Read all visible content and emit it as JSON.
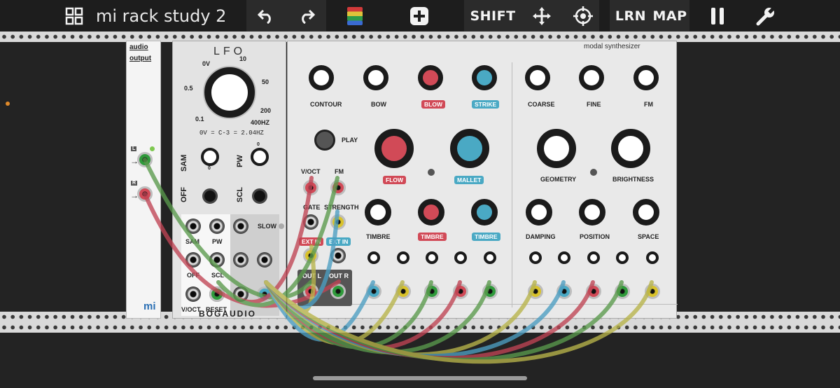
{
  "toolbar": {
    "title": "mi rack study 2",
    "shift": "SHIFT",
    "learn": "LRN",
    "map": "MAP"
  },
  "audio_output": {
    "title_line1": "audio",
    "title_line2": "output",
    "left": "L",
    "right": "R",
    "brand": "mi"
  },
  "lfo": {
    "title": "LFO",
    "freq_scale": [
      "0V",
      "10",
      "0.5",
      "50",
      "0.1",
      "200",
      "400HZ"
    ],
    "tuning_note": "0V = C-3 = 2.04HZ",
    "knobs": {
      "sam": "SAM",
      "pw": "PW",
      "off": "OFF",
      "scl": "SCL"
    },
    "scale_marks": {
      "sam_max": "0",
      "pw_max": "0",
      "sam_min": "0"
    },
    "slow": "SLOW",
    "jacks": {
      "sam": "SAM",
      "pw": "PW",
      "off": "OFF",
      "scl": "SCL",
      "voct": "V/OCT",
      "reset": "RESET"
    },
    "brand": "BOGAUDIO"
  },
  "modal": {
    "title": "modal synthesizer",
    "knobs": {
      "contour": "CONTOUR",
      "bow": "BOW",
      "blow": "BLOW",
      "strike": "STRIKE",
      "coarse": "COARSE",
      "fine": "FINE",
      "fm": "FM",
      "flow": "FLOW",
      "mallet": "MALLET",
      "geometry": "GEOMETRY",
      "brightness": "BRIGHTNESS",
      "timbre": "TIMBRE",
      "timbre_blow": "TIMBRE",
      "timbre_strike": "TIMBRE",
      "damping": "DAMPING",
      "position": "POSITION",
      "space": "SPACE"
    },
    "play": "PLAY",
    "jacks": {
      "voct": "V/OCT",
      "fm": "FM",
      "gate": "GATE",
      "strength": "STRENGTH",
      "ext_in_l": "EXT IN",
      "ext_in_r": "EXT IN",
      "out_l": "OUT L",
      "out_r": "OUT R"
    }
  },
  "colors": {
    "red": "#d14a57",
    "teal": "#4aa9c4",
    "green": "#2f9a3b",
    "yellow": "#d9c22b",
    "cable_green": "#5a9a4c",
    "cable_red": "#c04454",
    "cable_blue": "#4c9ec2",
    "cable_yellow": "#b8b44a"
  }
}
